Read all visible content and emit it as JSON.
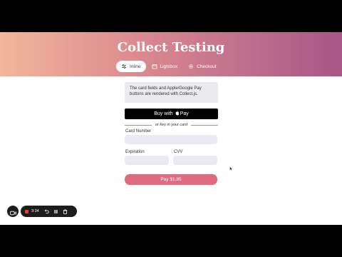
{
  "header": {
    "title": "Collect Testing"
  },
  "tabs": [
    {
      "label": "Inline",
      "icon": "sliders-icon",
      "active": true
    },
    {
      "label": "Lightbox",
      "icon": "calendar-icon",
      "active": false
    },
    {
      "label": "Checkout",
      "icon": "gear-icon",
      "active": false
    }
  ],
  "info": {
    "text": "The card fields and Apple/Google Pay buttons are rendered with Collect.js."
  },
  "apple_pay": {
    "prefix": "Buy with",
    "brand": "Pay"
  },
  "divider": {
    "text": "or key in your card"
  },
  "form": {
    "card_number_label": "Card Number",
    "expiration_label": "Expiration",
    "cvv_label": "CVV"
  },
  "pay_button": {
    "label": "Pay $1.85"
  },
  "recorder": {
    "time": "3:34"
  },
  "colors": {
    "header_gradient_start": "#f2b69b",
    "header_gradient_end": "#a95686",
    "pay_button": "#df6b83",
    "field_background": "#ece8f4",
    "record_stop": "#e0413a"
  }
}
